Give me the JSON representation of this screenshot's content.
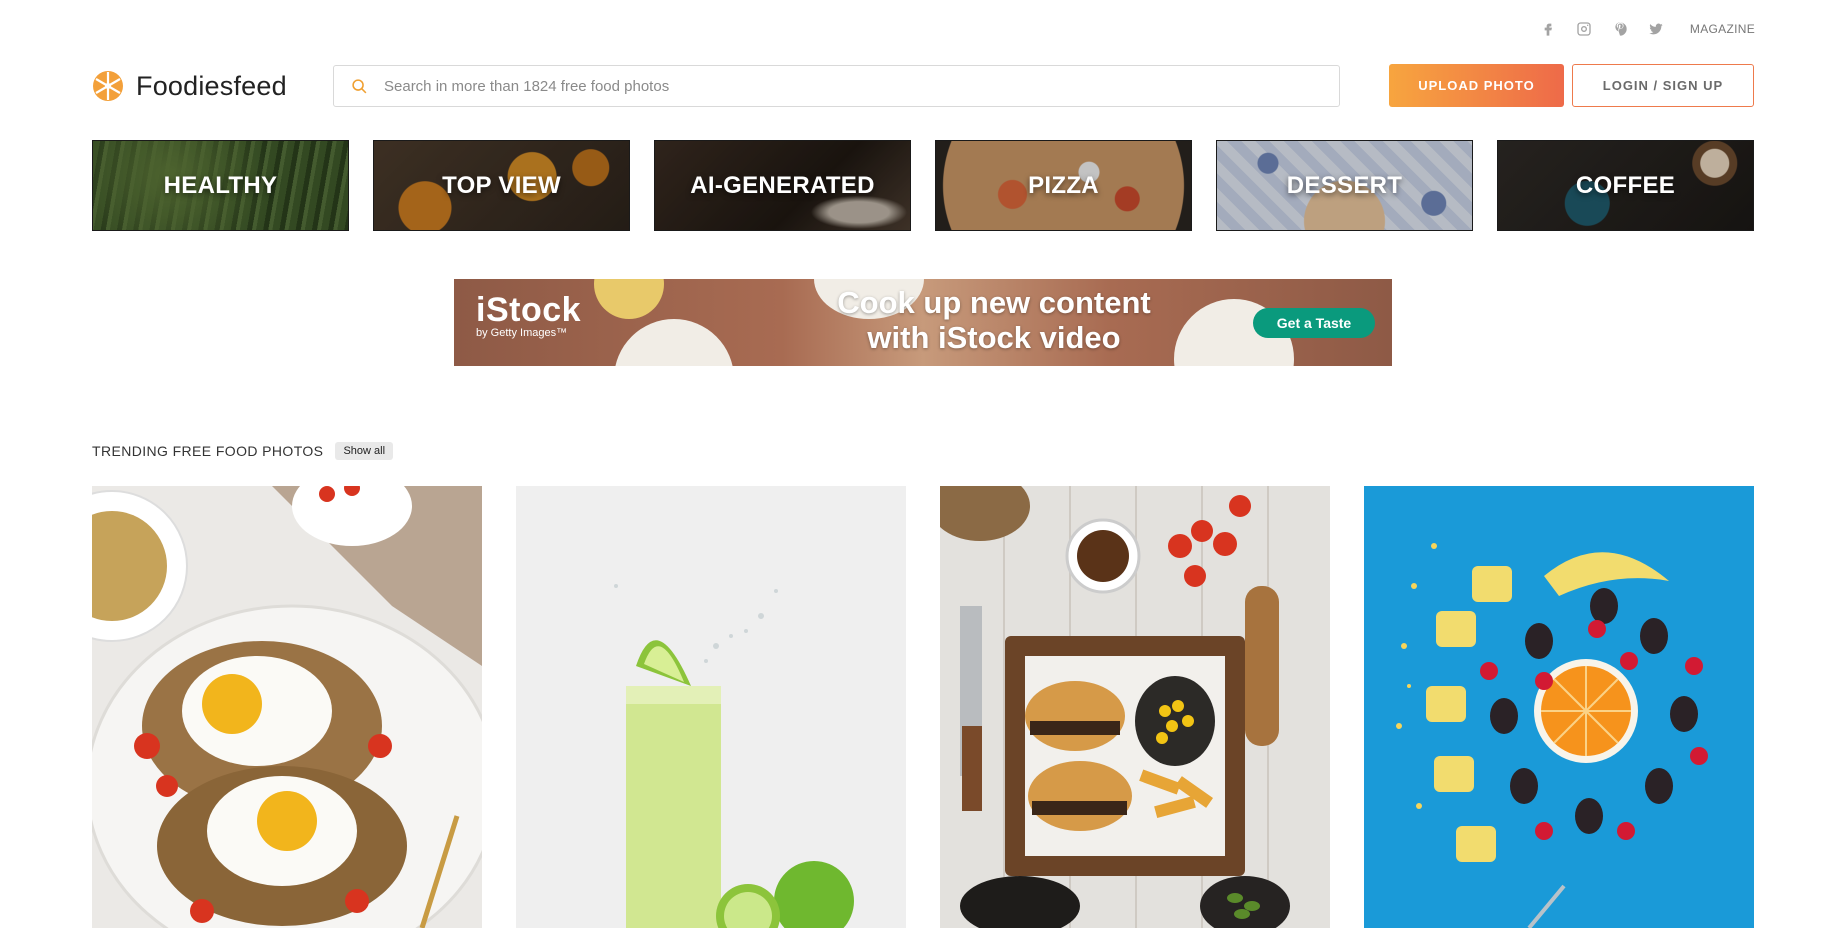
{
  "topbar": {
    "social": [
      {
        "icon": "facebook-icon"
      },
      {
        "icon": "instagram-icon"
      },
      {
        "icon": "pinterest-icon"
      },
      {
        "icon": "twitter-icon"
      }
    ],
    "magazine_label": "MAGAZINE"
  },
  "header": {
    "logo_text": "Foodiesfeed",
    "search_placeholder": "Search in more than 1824 free food photos",
    "search_value": "",
    "upload_label": "UPLOAD PHOTO",
    "login_label": "LOGIN / SIGN UP"
  },
  "categories": [
    {
      "label": "HEALTHY"
    },
    {
      "label": "TOP VIEW"
    },
    {
      "label": "AI-GENERATED"
    },
    {
      "label": "PIZZA"
    },
    {
      "label": "DESSERT"
    },
    {
      "label": "COFFEE"
    }
  ],
  "banner": {
    "brand": "iStock",
    "brand_sub": "by Getty Images™",
    "headline_1": "Cook up new content",
    "headline_2": "with iStock video",
    "cta": "Get a Taste"
  },
  "trending": {
    "title": "TRENDING FREE FOOD PHOTOS",
    "show_all": "Show all"
  },
  "colors": {
    "accent_start": "#f7a53f",
    "accent_end": "#ee6a49",
    "banner_cta": "#0a9a7d"
  }
}
